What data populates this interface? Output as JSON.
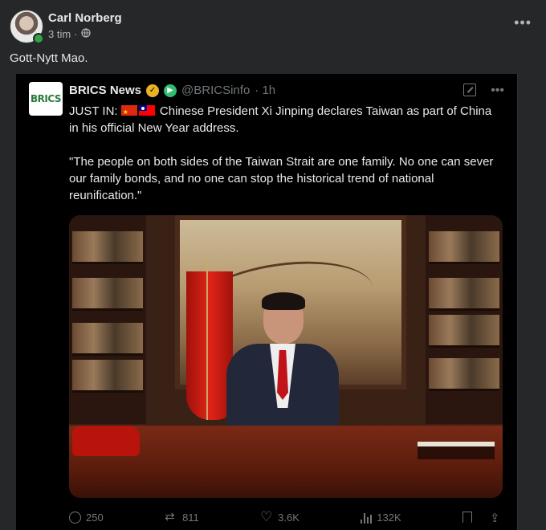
{
  "post": {
    "author": "Carl Norberg",
    "time": "3 tim",
    "separator": "·",
    "privacy_icon": "globe-icon",
    "more_label": "•••",
    "text": "Gott-Nytt Mao."
  },
  "tweet": {
    "logo_text": "BRICS",
    "name": "BRICS News",
    "handle": "@BRICSinfo",
    "age": "· 1h",
    "more_label": "•••",
    "lead": "JUST IN:",
    "line1": "Chinese President Xi Jinping declares Taiwan as part of China in his official New Year address.",
    "quote": "\"The people on both sides of the Taiwan Strait are one family. No one can sever our family bonds, and no one can stop the historical trend of national reunification.\"",
    "stats": {
      "replies": "250",
      "retweets": "811",
      "likes": "3.6K",
      "views": "132K"
    }
  },
  "colors": {
    "card": "#252728",
    "tweet_bg": "#000000",
    "muted": "#71767b",
    "online": "#31a24c",
    "verified_gold": "#e8b425"
  }
}
